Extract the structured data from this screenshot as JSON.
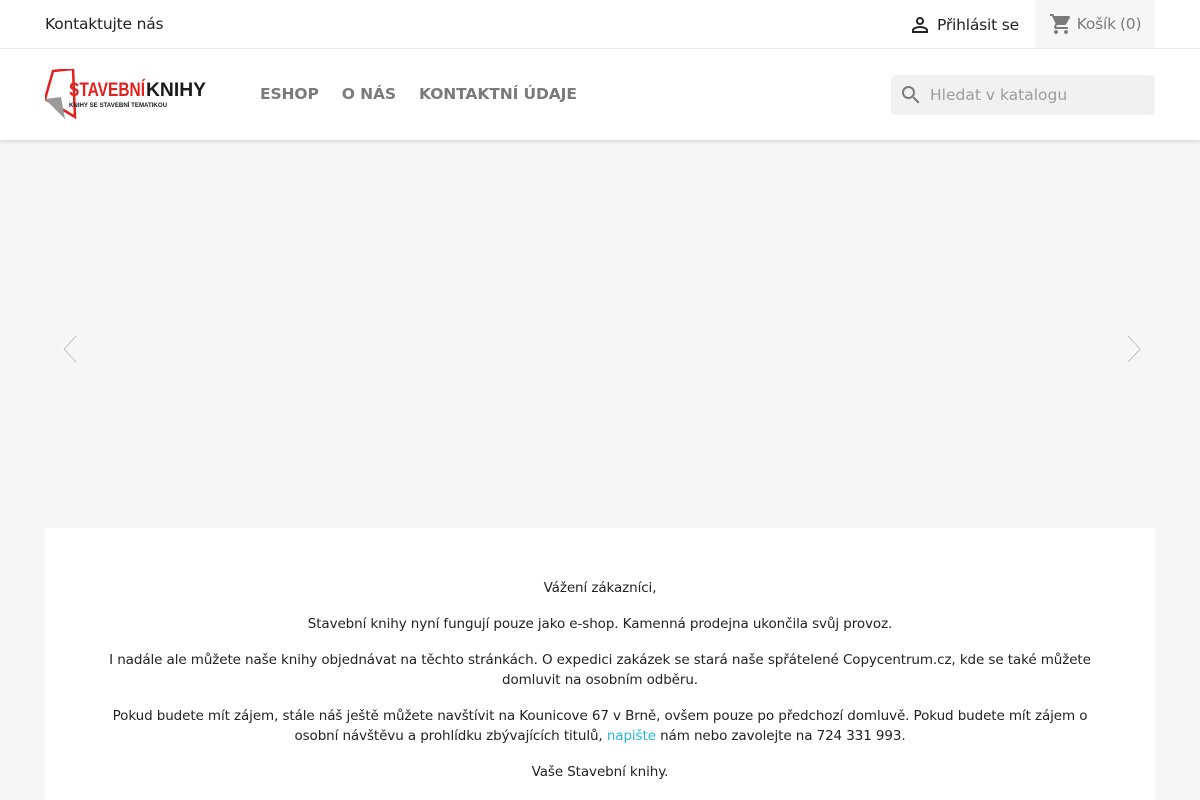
{
  "topbar": {
    "contact": "Kontaktujte nás",
    "signin": "Přihlásit se",
    "cart_label": "Košík",
    "cart_count": "(0)"
  },
  "header": {
    "logo_text": "STAVEBNÍ KNIHY",
    "logo_tagline": "KNIHY SE STAVEBNÍ TEMATIKOU",
    "nav": [
      "ESHOP",
      "O NÁS",
      "KONTAKTNÍ ÚDAJE"
    ],
    "search_placeholder": "Hledat v katalogu"
  },
  "notice": {
    "greeting": "Vážení zákazníci,",
    "p1": "Stavební knihy nyní fungují pouze jako e-shop. Kamenná prodejna ukončila svůj provoz.",
    "p2": "I nadále ale můžete naše knihy objednávat na těchto stránkách. O expedici zakázek se stará naše spřátelené Copycentrum.cz, kde se také můžete domluvit na osobním odběru.",
    "p3_before": "Pokud budete mít zájem, stále náš ještě můžete navštívit na Kounicove 67 v Brně, ovšem pouze po předchozí domluvě. Pokud budete mít zájem o osobní návštěvu a prohlídku zbývajících titulů, ",
    "p3_link": "napište",
    "p3_after": " nám nebo zavolejte na 724 331 993.",
    "signoff": "Vaše Stavební knihy."
  },
  "colors": {
    "accent": "#24b9d7",
    "logo_red": "#e3201b",
    "nav_gray": "#7a7a7a"
  },
  "icons": [
    "person-icon",
    "cart-icon",
    "search-icon",
    "chevron-left-icon",
    "chevron-right-icon"
  ]
}
